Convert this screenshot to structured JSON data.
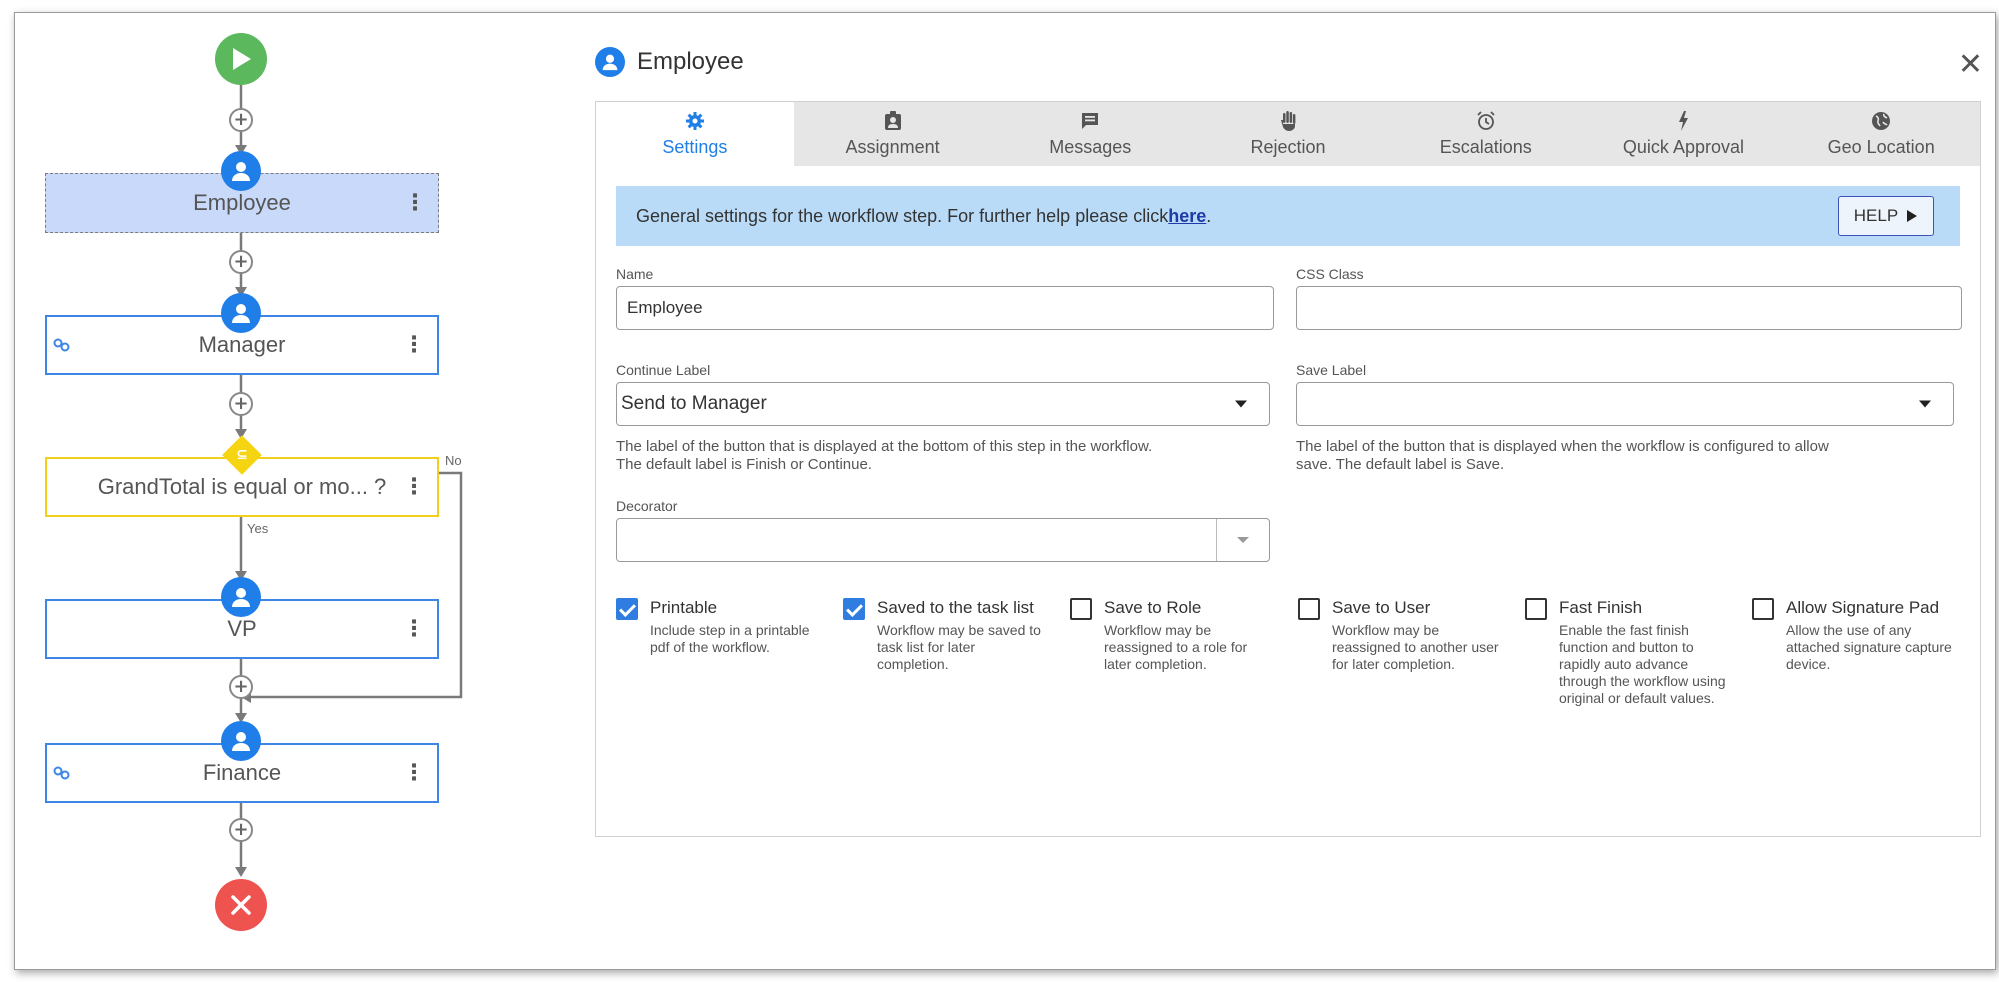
{
  "workflow": {
    "steps": [
      {
        "label": "Employee",
        "type": "user",
        "selected": true,
        "linked": false
      },
      {
        "label": "Manager",
        "type": "user",
        "selected": false,
        "linked": true
      },
      {
        "label": "GrandTotal is equal or mo... ?",
        "type": "condition",
        "selected": false,
        "linked": false
      },
      {
        "label": "VP",
        "type": "user",
        "selected": false,
        "linked": false
      },
      {
        "label": "Finance",
        "type": "user",
        "selected": false,
        "linked": true
      }
    ],
    "branch_yes": "Yes",
    "branch_no": "No",
    "start_icon": "play-icon",
    "end_icon": "close-icon",
    "colors": {
      "step_border": "#3d86e6",
      "selected_bg": "#c9d9f9",
      "condition": "#f2cf1a",
      "start": "#5cb85c",
      "end": "#ef5350"
    }
  },
  "dialog": {
    "title": "Employee",
    "tabs": [
      {
        "label": "Settings",
        "icon": "gear-icon",
        "active": true
      },
      {
        "label": "Assignment",
        "icon": "badge-icon",
        "active": false
      },
      {
        "label": "Messages",
        "icon": "message-icon",
        "active": false
      },
      {
        "label": "Rejection",
        "icon": "hand-icon",
        "active": false
      },
      {
        "label": "Escalations",
        "icon": "alarm-icon",
        "active": false
      },
      {
        "label": "Quick Approval",
        "icon": "lightning-icon",
        "active": false
      },
      {
        "label": "Geo Location",
        "icon": "globe-icon",
        "active": false
      }
    ],
    "banner": {
      "text": "General settings for the workflow step. For further help please click ",
      "link": "here",
      "suffix": ".",
      "help_label": "HELP"
    },
    "fields": {
      "name": {
        "label": "Name",
        "value": "Employee"
      },
      "css_class": {
        "label": "CSS Class",
        "value": ""
      },
      "continue_label": {
        "label": "Continue Label",
        "value": "Send to Manager",
        "hint": "The label of the button that is displayed at the bottom of this step in the workflow. The default label is Finish or Continue."
      },
      "save_label": {
        "label": "Save Label",
        "value": "",
        "hint": "The label of the button that is displayed when the workflow is configured to allow save. The default label is Save."
      },
      "decorator": {
        "label": "Decorator",
        "value": ""
      }
    },
    "options": [
      {
        "title": "Printable",
        "desc": "Include step in a printable pdf of the workflow.",
        "checked": true
      },
      {
        "title": "Saved to the task list",
        "desc": "Workflow may be saved to task list for later completion.",
        "checked": true
      },
      {
        "title": "Save to Role",
        "desc": "Workflow may be reassigned to a role for later completion.",
        "checked": false
      },
      {
        "title": "Save to User",
        "desc": "Workflow may be reassigned to another user for later completion.",
        "checked": false
      },
      {
        "title": "Fast Finish",
        "desc": "Enable the fast finish function and button to rapidly auto advance through the workflow using original or default values.",
        "checked": false
      },
      {
        "title": "Allow Signature Pad",
        "desc": "Allow the use of any attached signature capture device.",
        "checked": false
      }
    ],
    "accent": "#1f7ee8",
    "banner_bg": "#b9dbf7"
  }
}
